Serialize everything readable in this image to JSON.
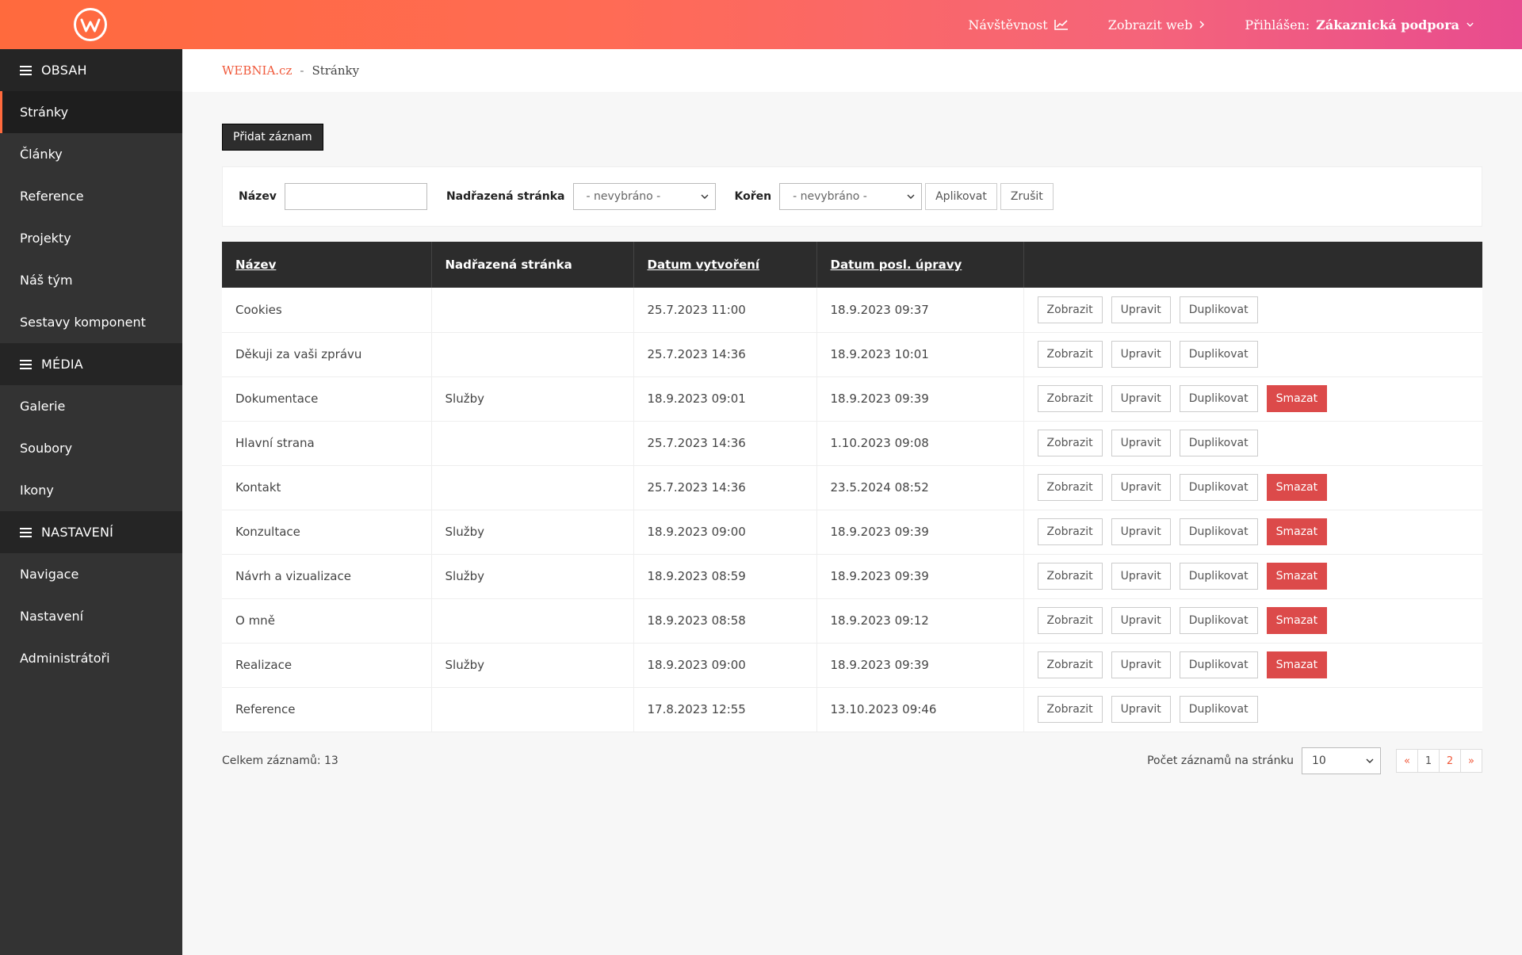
{
  "topbar": {
    "stats_label": "Návštěvnost",
    "view_web_label": "Zobrazit web",
    "logged_label": "Přihlášen:",
    "user_name": "Zákaznická podpora"
  },
  "sidebar": {
    "sections": [
      {
        "title": "OBSAH",
        "items": [
          "Stránky",
          "Články",
          "Reference",
          "Projekty",
          "Náš tým",
          "Sestavy komponent"
        ]
      },
      {
        "title": "MÉDIA",
        "items": [
          "Galerie",
          "Soubory",
          "Ikony"
        ]
      },
      {
        "title": "NASTAVENÍ",
        "items": [
          "Navigace",
          "Nastavení",
          "Administrátoři"
        ]
      }
    ],
    "active": "Stránky"
  },
  "breadcrumb": {
    "root": "WEBNIA.cz",
    "sep": "-",
    "current": "Stránky"
  },
  "add_button": "Přidat záznam",
  "filter": {
    "name_label": "Název",
    "name_value": "",
    "parent_label": "Nadřazená stránka",
    "parent_value": "- nevybráno -",
    "root_label": "Kořen",
    "root_value": "- nevybráno -",
    "apply": "Aplikovat",
    "cancel": "Zrušit"
  },
  "table": {
    "headers": [
      "Název",
      "Nadřazená stránka",
      "Datum vytvoření",
      "Datum posl. úpravy",
      ""
    ],
    "action_labels": {
      "view": "Zobrazit",
      "edit": "Upravit",
      "duplicate": "Duplikovat",
      "delete": "Smazat"
    },
    "rows": [
      {
        "name": "Cookies",
        "parent": "",
        "created": "25.7.2023 11:00",
        "modified": "18.9.2023 09:37",
        "deletable": false
      },
      {
        "name": "Děkuji za vaši zprávu",
        "parent": "",
        "created": "25.7.2023 14:36",
        "modified": "18.9.2023 10:01",
        "deletable": false
      },
      {
        "name": "Dokumentace",
        "parent": "Služby",
        "created": "18.9.2023 09:01",
        "modified": "18.9.2023 09:39",
        "deletable": true
      },
      {
        "name": "Hlavní strana",
        "parent": "",
        "created": "25.7.2023 14:36",
        "modified": "1.10.2023 09:08",
        "deletable": false
      },
      {
        "name": "Kontakt",
        "parent": "",
        "created": "25.7.2023 14:36",
        "modified": "23.5.2024 08:52",
        "deletable": true
      },
      {
        "name": "Konzultace",
        "parent": "Služby",
        "created": "18.9.2023 09:00",
        "modified": "18.9.2023 09:39",
        "deletable": true
      },
      {
        "name": "Návrh a vizualizace",
        "parent": "Služby",
        "created": "18.9.2023 08:59",
        "modified": "18.9.2023 09:39",
        "deletable": true
      },
      {
        "name": "O mně",
        "parent": "",
        "created": "18.9.2023 08:58",
        "modified": "18.9.2023 09:12",
        "deletable": true
      },
      {
        "name": "Realizace",
        "parent": "Služby",
        "created": "18.9.2023 09:00",
        "modified": "18.9.2023 09:39",
        "deletable": true
      },
      {
        "name": "Reference",
        "parent": "",
        "created": "17.8.2023 12:55",
        "modified": "13.10.2023 09:46",
        "deletable": false
      }
    ]
  },
  "footer": {
    "total": "Celkem záznamů: 13",
    "per_page_label": "Počet záznamů na stránku",
    "per_page_value": "10",
    "pages": [
      "«",
      "1",
      "2",
      "»"
    ]
  },
  "colors": {
    "accent": "#f05a3c",
    "danger": "#dc4a4a",
    "sidebar": "#333333"
  }
}
